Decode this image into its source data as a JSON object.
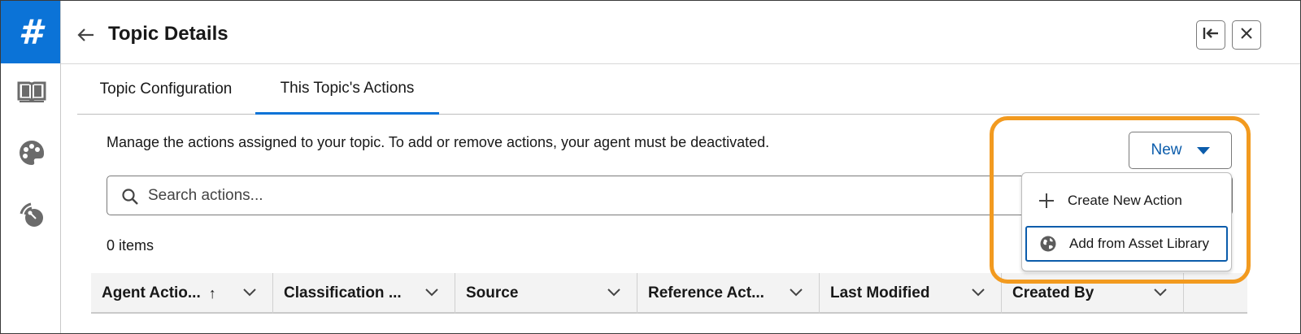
{
  "rail": {
    "logo": "#",
    "items": [
      {
        "icon": "book-icon"
      },
      {
        "icon": "palette-icon"
      },
      {
        "icon": "signal-icon"
      }
    ]
  },
  "header": {
    "title": "Topic Details",
    "back_icon": "arrow-left-icon",
    "buttons": [
      {
        "icon": "collapse-left-icon"
      },
      {
        "icon": "close-icon"
      }
    ]
  },
  "tabs": [
    {
      "label": "Topic Configuration",
      "active": false
    },
    {
      "label": "This Topic's Actions",
      "active": true
    }
  ],
  "main": {
    "description": "Manage the actions assigned to your topic. To add or remove actions, your agent must be deactivated.",
    "new_button": {
      "label": "New",
      "icon": "caret-down-icon"
    },
    "search": {
      "placeholder": "Search actions...",
      "value": ""
    },
    "item_count": "0 items"
  },
  "table": {
    "columns": [
      {
        "label": "Agent Actio...",
        "sorted": "ascending"
      },
      {
        "label": "Classification ..."
      },
      {
        "label": "Source"
      },
      {
        "label": "Reference Act..."
      },
      {
        "label": "Last Modified"
      },
      {
        "label": "Created By"
      }
    ]
  },
  "dropdown": {
    "items": [
      {
        "label": "Create New Action",
        "icon": "plus-icon"
      },
      {
        "label": "Add from Asset Library",
        "icon": "globe-icon",
        "focused": true
      }
    ]
  },
  "colors": {
    "brand": "#0b73d7",
    "link": "#0b5cab",
    "highlight": "#f29a1f"
  }
}
